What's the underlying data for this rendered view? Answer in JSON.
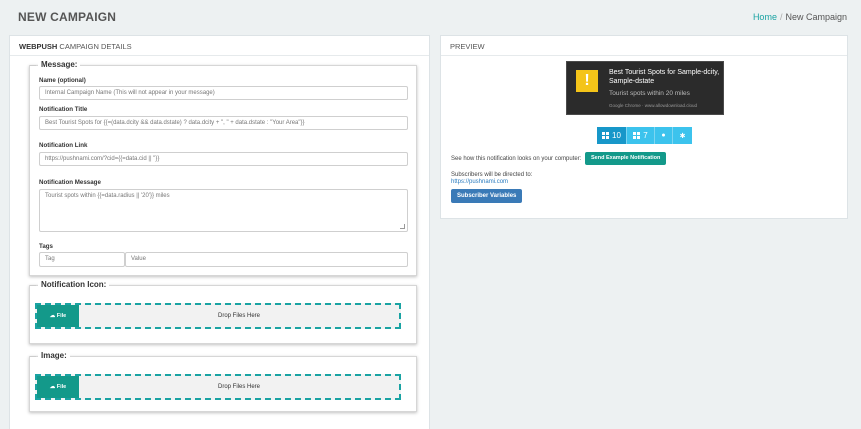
{
  "page": {
    "title": "NEW CAMPAIGN"
  },
  "breadcrumb": {
    "home": "Home",
    "separator": "/",
    "current": "New Campaign"
  },
  "details": {
    "heading_bold": "WEBPUSH",
    "heading_rest": " CAMPAIGN DETAILS",
    "message": {
      "legend": "Message:",
      "name_label": "Name (optional)",
      "name_placeholder": "Internal Campaign Name (This will not appear in your message)",
      "title_label": "Notification Title",
      "title_value": "Best Tourist Spots for {{=(data.dcity && data.dstate) ? data.dcity + \", \" + data.dstate : \"Your Area\"}}",
      "link_label": "Notification Link",
      "link_value": "https://pushnami.com/?cid={{=data.cid || \"}}",
      "message_label": "Notification Message",
      "message_value": "Tourist spots within {{=data.radius || '20'}} miles",
      "tags_label": "Tags",
      "tag_placeholder": "Tag",
      "value_placeholder": "Value"
    },
    "icon": {
      "legend": "Notification Icon:",
      "file_label": "File",
      "drop_text": "Drop Files Here"
    },
    "image": {
      "legend": "Image:",
      "file_label": "File",
      "drop_text": "Drop Files Here"
    }
  },
  "preview": {
    "heading": "PREVIEW",
    "notification": {
      "icon_glyph": "!",
      "title": "Best Tourist Spots for Sample-dcity, Sample-dstate",
      "body": "Tourist spots within 20 miles",
      "footer": "Google Chrome · www.allowdownload.cloud"
    },
    "os_tabs": [
      {
        "label": "10",
        "icon": "windows-icon",
        "active": true
      },
      {
        "label": "7",
        "icon": "windows-icon",
        "active": false
      },
      {
        "label": "",
        "icon": "apple-icon",
        "active": false
      },
      {
        "label": "",
        "icon": "android-icon",
        "active": false
      }
    ],
    "see_text": "See how this notification looks on your computer:",
    "send_button": "Send Example Notification",
    "directed_text": "Subscribers will be directed to:",
    "directed_link": "https://pushnami.com",
    "vars_button": "Subscriber Variables"
  },
  "colors": {
    "accent": "#13998a",
    "link": "#1aa3a3",
    "tab_active": "#1797c9",
    "tab": "#3cc3ed",
    "notif_icon": "#f4c419",
    "vars_button": "#3a7ab7"
  }
}
